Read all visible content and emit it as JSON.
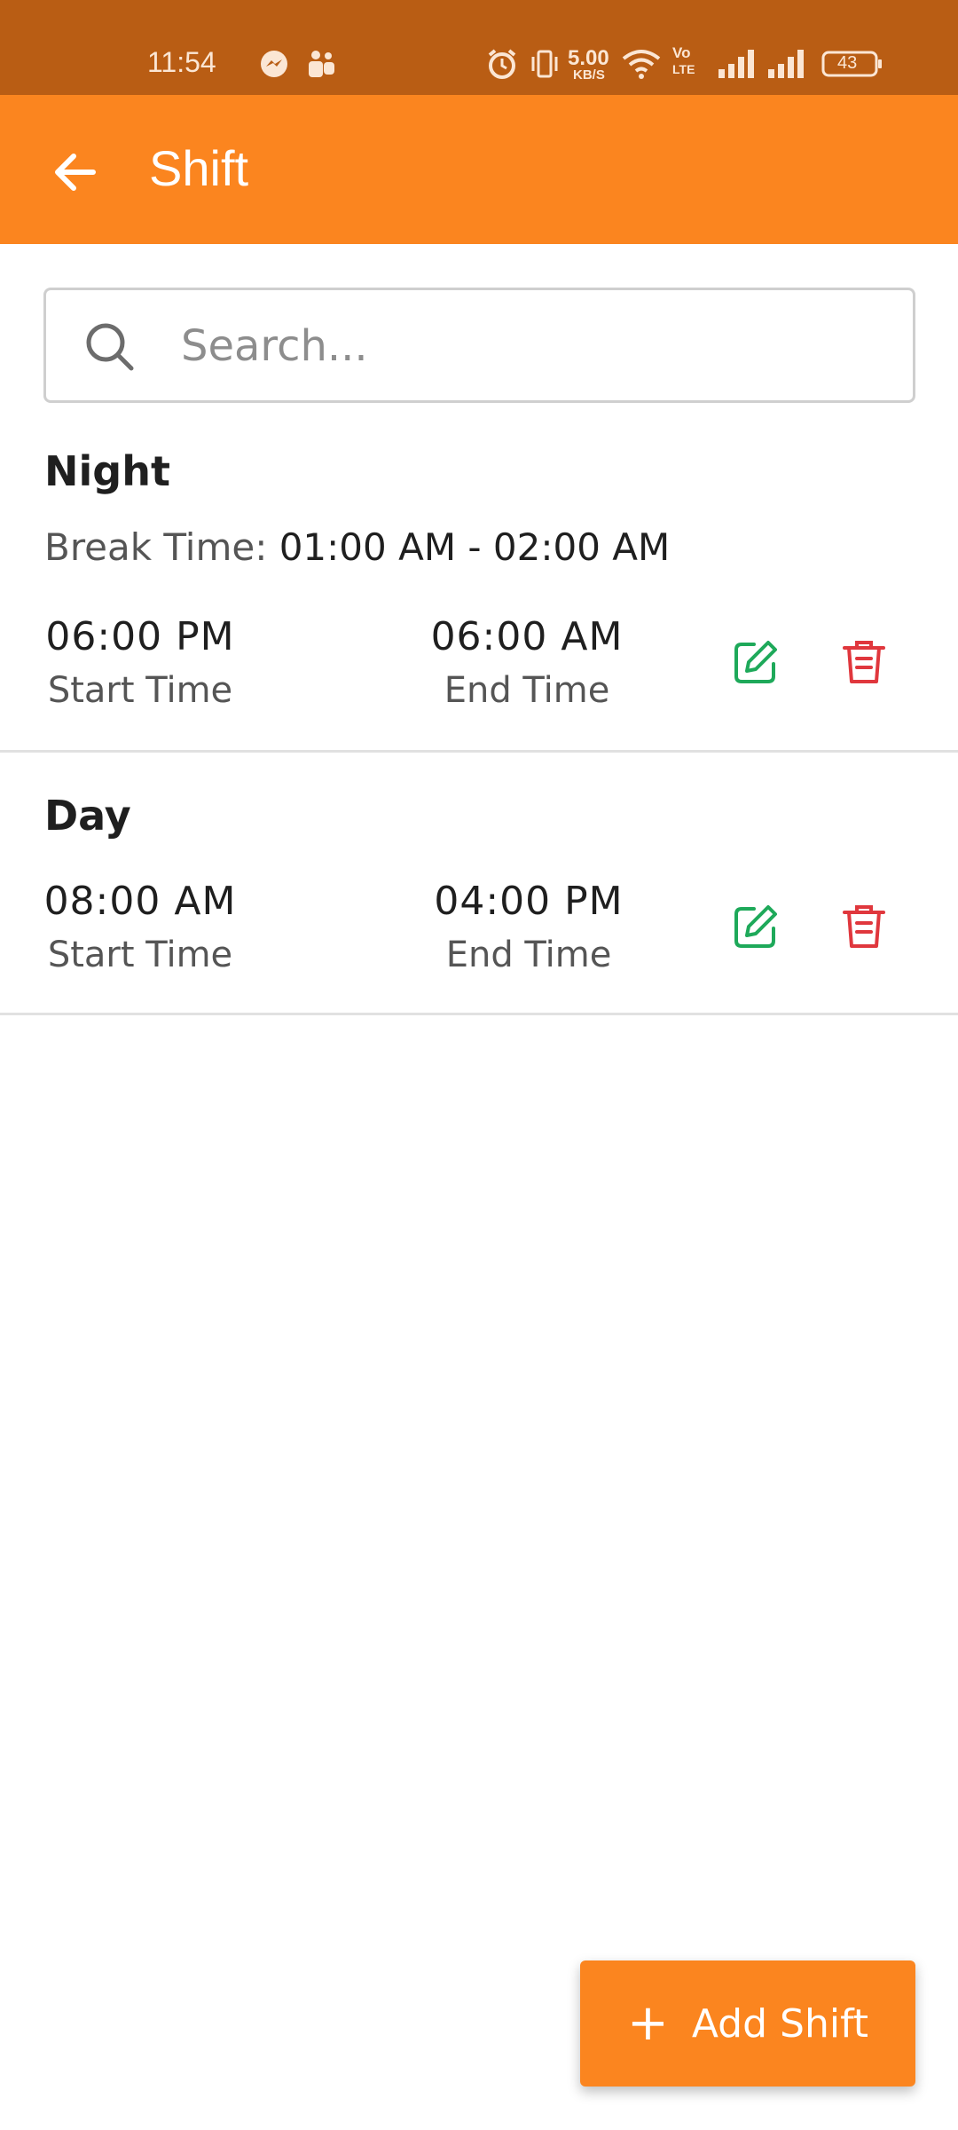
{
  "status_bar": {
    "time": "11:54",
    "net_speed_value": "5.00",
    "net_speed_unit": "KB/S",
    "volte_top": "Vo",
    "volte_bottom": "LTE",
    "battery": "43"
  },
  "app_bar": {
    "title": "Shift"
  },
  "search": {
    "placeholder": "Search..."
  },
  "shifts": [
    {
      "name": "Night",
      "break_label": "Break Time:",
      "break_value": "01:00 AM - 02:00 AM",
      "start_time": "06:00 PM",
      "start_label": "Start Time",
      "end_time": "06:00 AM",
      "end_label": "End Time"
    },
    {
      "name": "Day",
      "start_time": "08:00 AM",
      "start_label": "Start Time",
      "end_time": "04:00 PM",
      "end_label": "End Time"
    }
  ],
  "fab": {
    "icon": "+",
    "label": "Add Shift"
  },
  "colors": {
    "status_bar": "#b95d14",
    "app_bar": "#fb851f",
    "edit": "#1ea95a",
    "delete": "#e0373d"
  }
}
